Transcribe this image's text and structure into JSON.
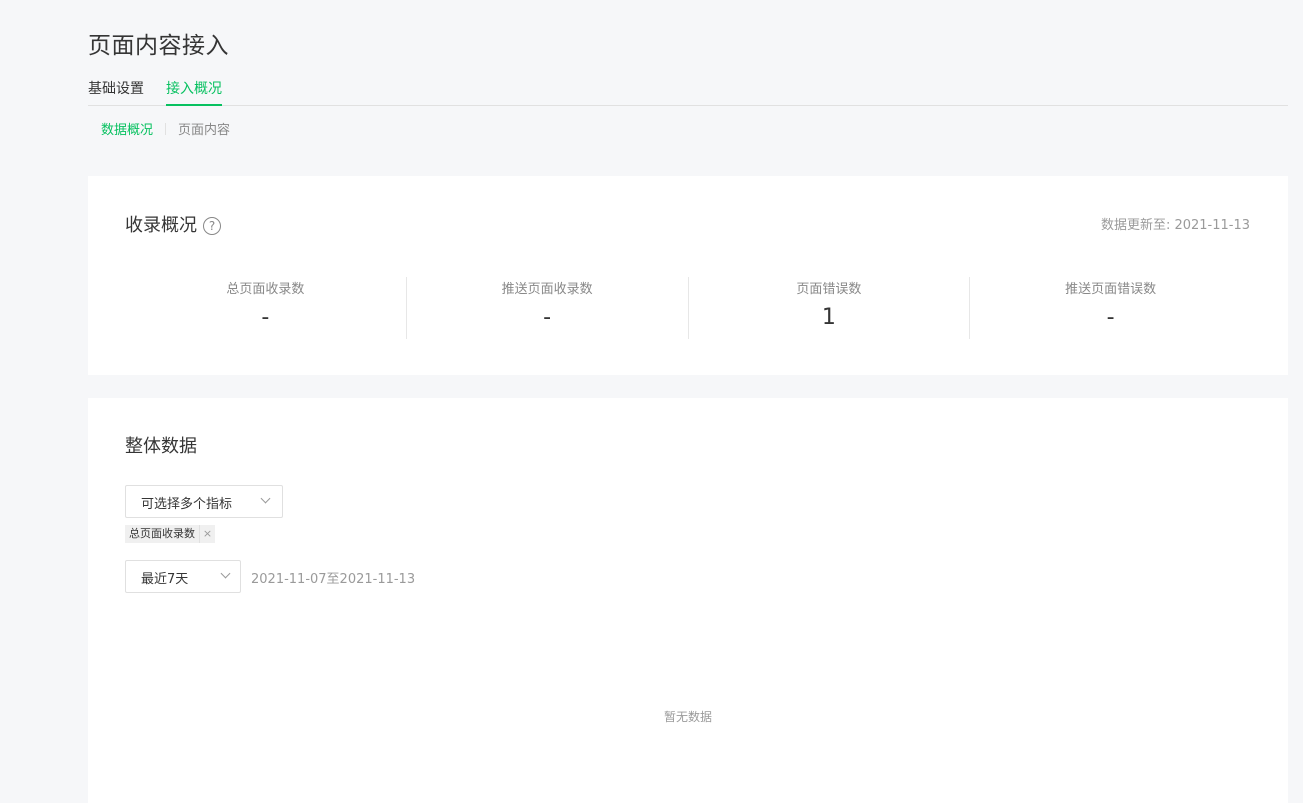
{
  "page": {
    "title": "页面内容接入"
  },
  "tabs": [
    {
      "label": "基础设置",
      "active": false
    },
    {
      "label": "接入概况",
      "active": true
    }
  ],
  "subtabs": [
    {
      "label": "数据概况",
      "active": true
    },
    {
      "label": "页面内容",
      "active": false
    }
  ],
  "overview": {
    "title": "收录概况",
    "help_icon": "question-circle-icon",
    "update_time": "数据更新至: 2021-11-13",
    "stats": [
      {
        "label": "总页面收录数",
        "value": "-"
      },
      {
        "label": "推送页面收录数",
        "value": "-"
      },
      {
        "label": "页面错误数",
        "value": "1"
      },
      {
        "label": "推送页面错误数",
        "value": "-"
      }
    ]
  },
  "overall": {
    "title": "整体数据",
    "metric_select": {
      "placeholder": "可选择多个指标",
      "icon": "chevron-down-icon"
    },
    "selected_tags": [
      {
        "label": "总页面收录数",
        "close_icon": "close-icon",
        "close_glyph": "×"
      }
    ],
    "range_select": {
      "value": "最近7天",
      "icon": "chevron-down-icon"
    },
    "date_range": "2021-11-07至2021-11-13",
    "empty_text": "暂无数据"
  },
  "colors": {
    "accent": "#07c160",
    "background": "#f6f7f9",
    "card": "#ffffff",
    "text_primary": "#353535",
    "text_secondary": "#9a9a9a"
  }
}
